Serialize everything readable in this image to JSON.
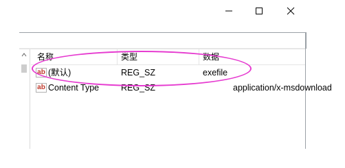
{
  "window": {
    "controls": {
      "minimize": "minimize-icon",
      "maximize": "maximize-icon",
      "close": "close-icon"
    }
  },
  "table": {
    "columns": [
      "名称",
      "类型",
      "数据"
    ],
    "rows": [
      {
        "name": "(默认)",
        "type": "REG_SZ",
        "data": "exefile"
      },
      {
        "name": "Content Type",
        "type": "REG_SZ",
        "data": "application/x-msdownload"
      }
    ]
  },
  "colors": {
    "highlight": "#e63bd0",
    "value_icon_text": "#c0392b"
  }
}
